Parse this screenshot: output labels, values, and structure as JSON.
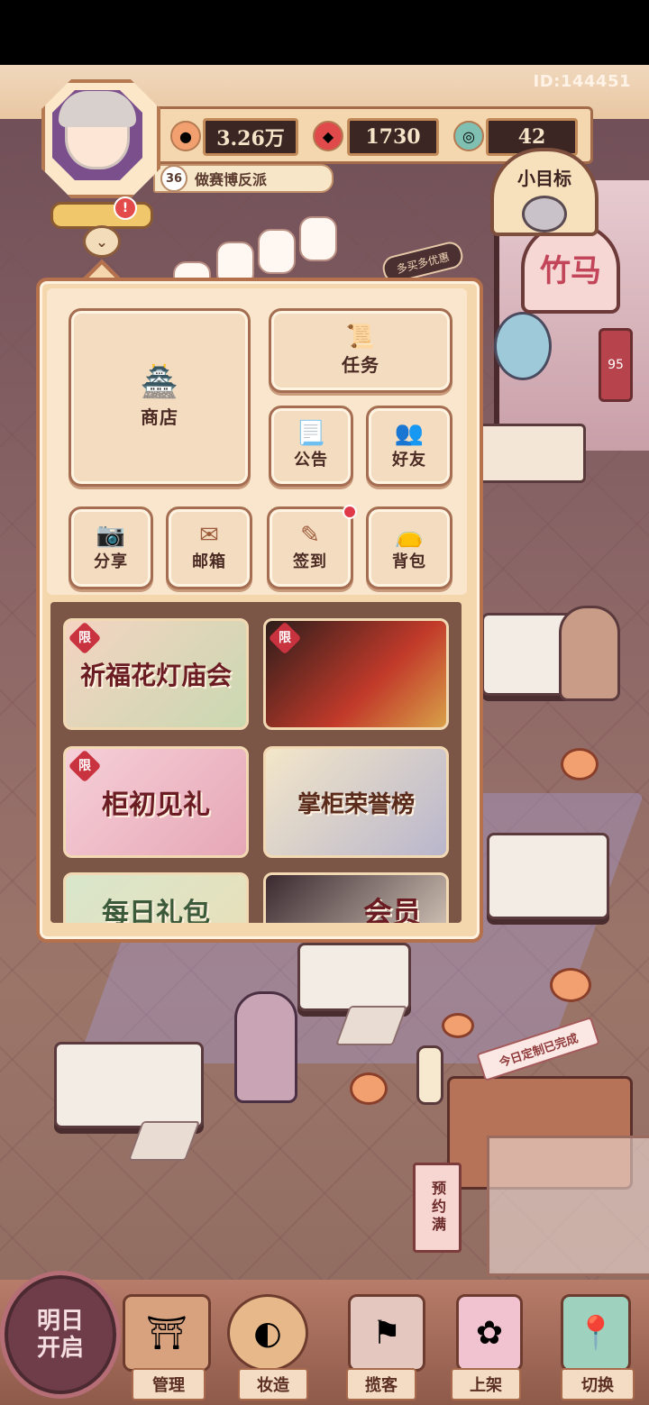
{
  "header": {
    "player_id": "ID:144451",
    "avatar": "player-avatar",
    "resources": [
      {
        "name": "coin",
        "icon": "coin-icon",
        "value": "3.26万"
      },
      {
        "name": "gem",
        "icon": "red-gem-icon",
        "value": "1730"
      },
      {
        "name": "jade",
        "icon": "jade-coin-icon",
        "value": "42"
      }
    ],
    "level": {
      "number": "36",
      "title": "做赛博反派"
    },
    "alert_badge": "!",
    "collapse_icon": "chevron-down-icon"
  },
  "goal": {
    "label": "小目标"
  },
  "scene": {
    "shop_sign": "竹马",
    "sign_tag": "95",
    "promo_tag": "多买多优惠",
    "customization_banner": "今日定制已完成",
    "reserve_sign": "预约满"
  },
  "menu": {
    "big_buttons": [
      {
        "id": "shop",
        "label": "商店",
        "icon": "shop-icon"
      },
      {
        "id": "task",
        "label": "任务",
        "icon": "scroll-book-icon"
      }
    ],
    "small_buttons": [
      {
        "id": "notice",
        "label": "公告",
        "icon": "notice-scroll-icon"
      },
      {
        "id": "friends",
        "label": "好友",
        "icon": "friends-icon"
      },
      {
        "id": "share",
        "label": "分享",
        "icon": "camera-icon"
      },
      {
        "id": "mail",
        "label": "邮箱",
        "icon": "mailbox-icon"
      },
      {
        "id": "checkin",
        "label": "签到",
        "icon": "checkin-brush-icon"
      },
      {
        "id": "bag",
        "label": "背包",
        "icon": "bag-icon"
      }
    ],
    "events": [
      {
        "id": "lantern-fair",
        "title": "祈福花灯庙会",
        "limited": "限"
      },
      {
        "id": "limited-hero",
        "title": "",
        "limited": "限"
      },
      {
        "id": "first-gift",
        "title": "柜初见礼",
        "limited": "限"
      },
      {
        "id": "honor-list",
        "title": "掌柜荣誉榜",
        "limited": ""
      },
      {
        "id": "daily-gift",
        "title": "每日礼包",
        "limited": ""
      },
      {
        "id": "member",
        "title": "会员",
        "limited": ""
      }
    ]
  },
  "bottom_nav": {
    "open_tomorrow": "明日开启",
    "tabs": [
      {
        "id": "manage",
        "label": "管理",
        "icon": "gate-icon"
      },
      {
        "id": "craft",
        "label": "妆造",
        "icon": "makeup-icon"
      },
      {
        "id": "attract",
        "label": "揽客",
        "icon": "signpost-icon"
      },
      {
        "id": "shelf",
        "label": "上架",
        "icon": "display-stand-icon"
      },
      {
        "id": "switch",
        "label": "切换",
        "icon": "map-pin-icon"
      }
    ]
  },
  "colors": {
    "menu_bg": "#f5d7ae",
    "menu_border": "#b5704c",
    "resource_bg": "#3b2624",
    "alert_red": "#e03a4a"
  }
}
